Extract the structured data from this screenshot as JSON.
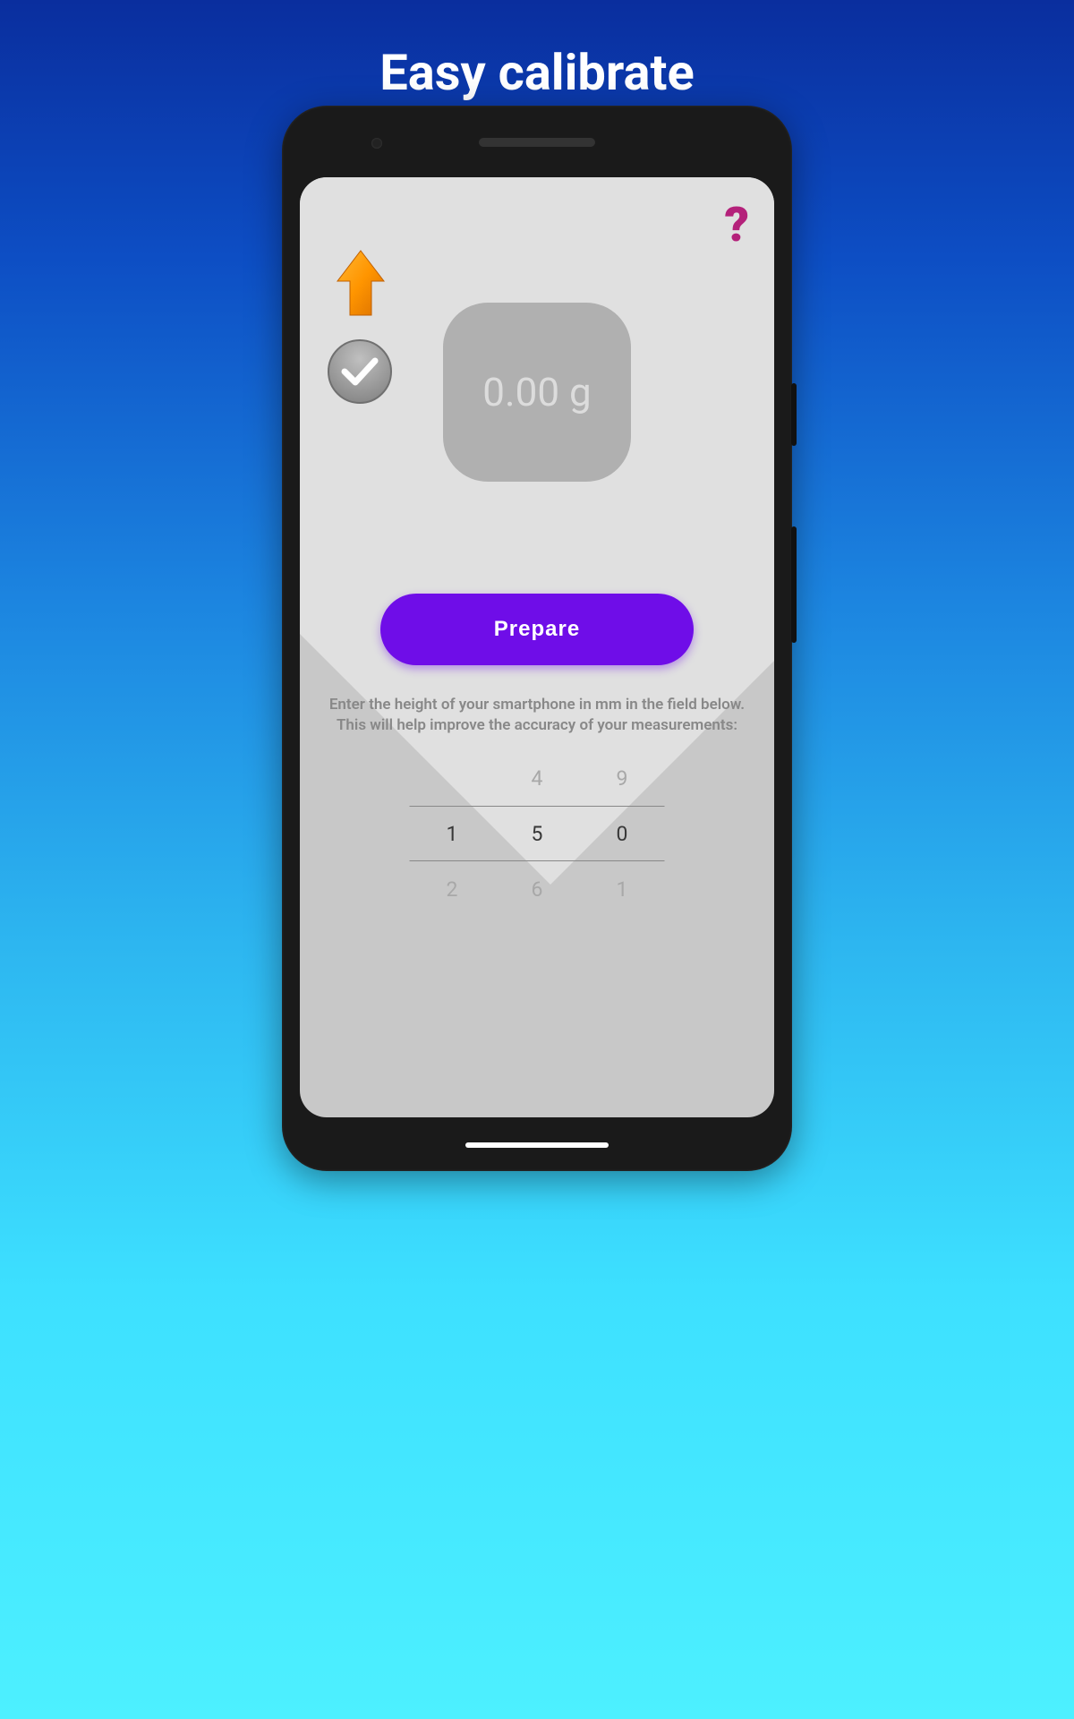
{
  "page": {
    "title": "Easy calibrate"
  },
  "help": {
    "glyph": "?"
  },
  "weight": {
    "display": "0.00 g"
  },
  "actions": {
    "prepare": "Prepare"
  },
  "instructions": {
    "line1": "Enter the height of your smartphone in mm in the field below.",
    "line2": "This will help improve the accuracy of your measurements:"
  },
  "picker": {
    "col1": {
      "above": "",
      "selected": "1",
      "below": "2"
    },
    "col2": {
      "above": "4",
      "selected": "5",
      "below": "6"
    },
    "col3": {
      "above": "9",
      "selected": "0",
      "below": "1"
    }
  }
}
